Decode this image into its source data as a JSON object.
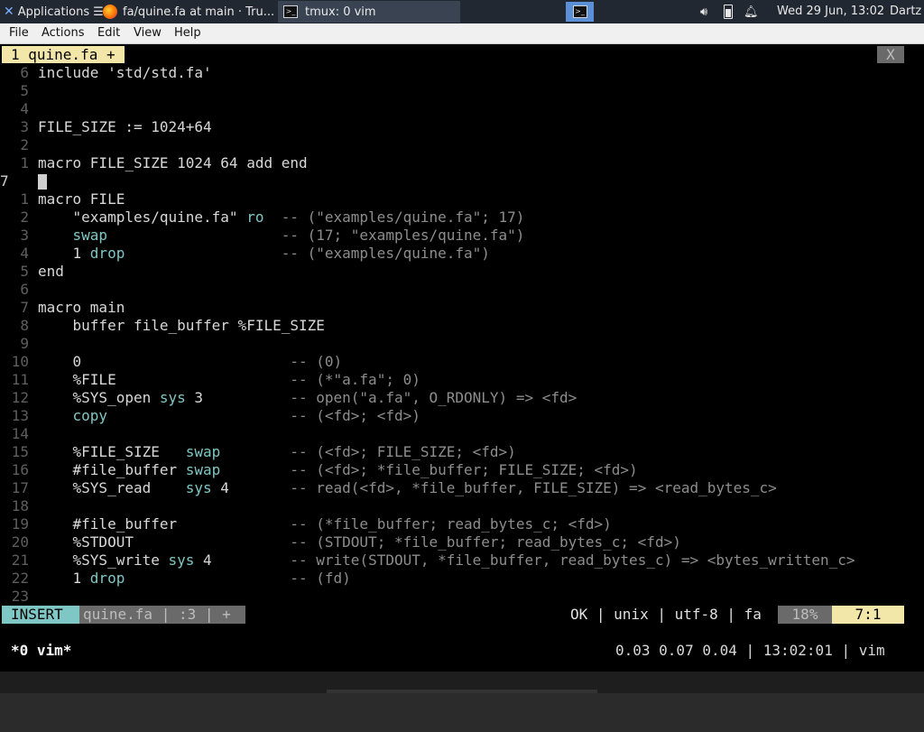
{
  "panel": {
    "applications_label": "Applications",
    "tasks": [
      {
        "label": "fa/quine.fa at main · Tru..."
      },
      {
        "label": "tmux: 0 vim"
      }
    ],
    "clock": "Wed 29 Jun, 13:02",
    "user": "Dartz"
  },
  "menubar": {
    "items": [
      "File",
      "Actions",
      "Edit",
      "View",
      "Help"
    ]
  },
  "vim": {
    "tab_label": "1 quine.fa +",
    "tab_close": "X",
    "lines": [
      {
        "n": "6",
        "text": "include 'std/std.fa'"
      },
      {
        "n": "5",
        "text": ""
      },
      {
        "n": "4",
        "text": ""
      },
      {
        "n": "3",
        "text": "FILE_SIZE := 1024+64"
      },
      {
        "n": "2",
        "text": ""
      },
      {
        "n": "1",
        "text": "macro FILE_SIZE 1024 64 add end"
      },
      {
        "n": "7",
        "text": ""
      },
      {
        "n": "1",
        "text": "macro FILE"
      },
      {
        "n": "2",
        "text": "    \"examples/quine.fa\" ro  -- (\"examples/quine.fa\"; 17)"
      },
      {
        "n": "3",
        "text": "    swap                    -- (17; \"examples/quine.fa\")"
      },
      {
        "n": "4",
        "text": "    1 drop                  -- (\"examples/quine.fa\")"
      },
      {
        "n": "5",
        "text": "end"
      },
      {
        "n": "6",
        "text": ""
      },
      {
        "n": "7",
        "text": "macro main"
      },
      {
        "n": "8",
        "text": "    buffer file_buffer %FILE_SIZE"
      },
      {
        "n": "9",
        "text": ""
      },
      {
        "n": "10",
        "text": "    0                        -- (0)"
      },
      {
        "n": "11",
        "text": "    %FILE                    -- (*\"a.fa\"; 0)"
      },
      {
        "n": "12",
        "text": "    %SYS_open sys 3          -- open(\"a.fa\", O_RDONLY) => <fd>"
      },
      {
        "n": "13",
        "text": "    copy                     -- (<fd>; <fd>)"
      },
      {
        "n": "14",
        "text": ""
      },
      {
        "n": "15",
        "text": "    %FILE_SIZE   swap        -- (<fd>; FILE_SIZE; <fd>)"
      },
      {
        "n": "16",
        "text": "    #file_buffer swap        -- (<fd>; *file_buffer; FILE_SIZE; <fd>)"
      },
      {
        "n": "17",
        "text": "    %SYS_read    sys 4       -- read(<fd>, *file_buffer, FILE_SIZE) => <read_bytes_c>"
      },
      {
        "n": "18",
        "text": ""
      },
      {
        "n": "19",
        "text": "    #file_buffer             -- (*file_buffer; read_bytes_c; <fd>)"
      },
      {
        "n": "20",
        "text": "    %STDOUT                  -- (STDOUT; *file_buffer; read_bytes_c; <fd>)"
      },
      {
        "n": "21",
        "text": "    %SYS_write sys 4         -- write(STDOUT, *file_buffer, read_bytes_c) => <bytes_written_c>"
      },
      {
        "n": "22",
        "text": "    1 drop                   -- (fd)"
      },
      {
        "n": "23",
        "text": ""
      }
    ],
    "status": {
      "mode": "INSERT",
      "file": "quine.fa | :3 | +",
      "right": "OK | unix | utf-8 | fa",
      "percent": "18%",
      "position": "7:1"
    }
  },
  "tmux": {
    "window": "*0 vim*",
    "status_right": "0.03 0.07 0.04 | 13:02:01 | vim"
  }
}
